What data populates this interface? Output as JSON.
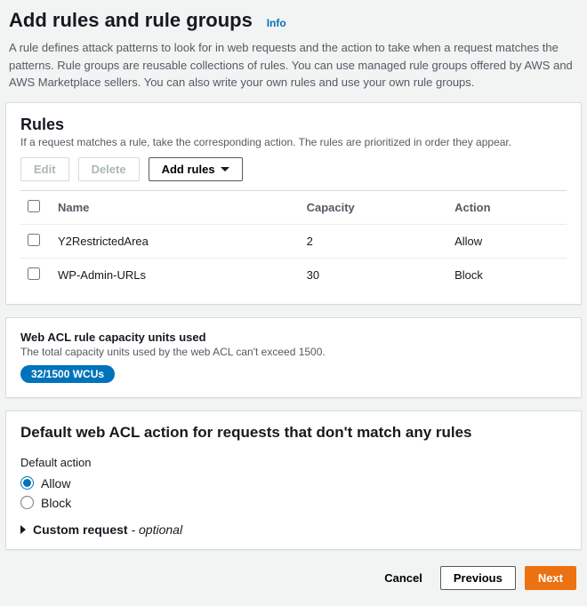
{
  "header": {
    "title": "Add rules and rule groups",
    "info": "Info",
    "intro": "A rule defines attack patterns to look for in web requests and the action to take when a request matches the patterns. Rule groups are reusable collections of rules. You can use managed rule groups offered by AWS and AWS Marketplace sellers. You can also write your own rules and use your own rule groups."
  },
  "rules": {
    "title": "Rules",
    "sub": "If a request matches a rule, take the corresponding action. The rules are prioritized in order they appear.",
    "edit": "Edit",
    "delete": "Delete",
    "add": "Add rules",
    "cols": {
      "name": "Name",
      "capacity": "Capacity",
      "action": "Action"
    },
    "rows": [
      {
        "name": "Y2RestrictedArea",
        "capacity": "2",
        "action": "Allow"
      },
      {
        "name": "WP-Admin-URLs",
        "capacity": "30",
        "action": "Block"
      }
    ]
  },
  "capacity": {
    "label": "Web ACL rule capacity units used",
    "sub": "The total capacity units used by the web ACL can't exceed 1500.",
    "badge": "32/1500 WCUs"
  },
  "defaultAction": {
    "title": "Default web ACL action for requests that don't match any rules",
    "label": "Default action",
    "allow": "Allow",
    "block": "Block",
    "custom": "Custom request",
    "optional": " - optional"
  },
  "footer": {
    "cancel": "Cancel",
    "previous": "Previous",
    "next": "Next"
  }
}
